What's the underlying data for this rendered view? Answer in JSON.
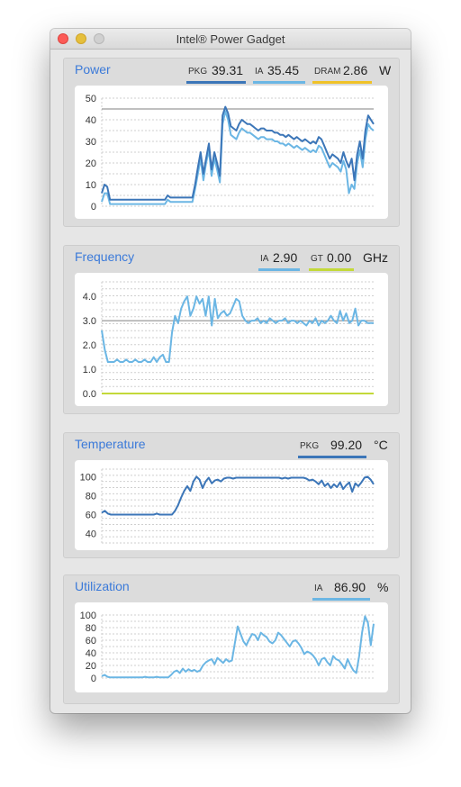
{
  "window": {
    "title": "Intel® Power Gadget"
  },
  "colors": {
    "pkg": "#3c76b8",
    "ia": "#6bb6e4",
    "dram": "#f0c228",
    "gt": "#c3d93a",
    "title_blue": "#3b7ad9"
  },
  "power": {
    "title": "Power",
    "pkg_label": "PKG",
    "pkg_value": "39.31",
    "ia_label": "IA",
    "ia_value": "35.45",
    "dram_label": "DRAM",
    "dram_value": "2.86",
    "unit": "W",
    "chart_data": {
      "type": "line",
      "y_ticks": [
        "50",
        "40",
        "30",
        "20",
        "10",
        "0"
      ],
      "ylim": [
        0,
        50
      ],
      "reference_line": 45,
      "series": [
        {
          "name": "PKG",
          "values": [
            6,
            10,
            9,
            3,
            3,
            3,
            3,
            3,
            3,
            3,
            3,
            3,
            3,
            3,
            3,
            3,
            3,
            3,
            3,
            3,
            3,
            3,
            3,
            3,
            5,
            4,
            4,
            4,
            4,
            4,
            4,
            4,
            4,
            4,
            10,
            18,
            25,
            15,
            22,
            29,
            17,
            25,
            20,
            14,
            42,
            46,
            43,
            37,
            36,
            35,
            38,
            40,
            39,
            38,
            38,
            37,
            36,
            35,
            36,
            36,
            35,
            35,
            35,
            34,
            34,
            33,
            33,
            32,
            33,
            32,
            31,
            32,
            31,
            30,
            31,
            30,
            29,
            30,
            29,
            32,
            31,
            28,
            25,
            22,
            24,
            23,
            22,
            20,
            25,
            21,
            18,
            22,
            12,
            24,
            30,
            22,
            35,
            42,
            40,
            38
          ]
        },
        {
          "name": "IA",
          "values": [
            2,
            6,
            6,
            1,
            1,
            1,
            1,
            1,
            1,
            1,
            1,
            1,
            1,
            1,
            1,
            1,
            1,
            1,
            1,
            1,
            1,
            1,
            1,
            1,
            3,
            2,
            2,
            2,
            2,
            2,
            2,
            2,
            2,
            2,
            8,
            15,
            22,
            12,
            20,
            26,
            14,
            22,
            17,
            11,
            38,
            44,
            40,
            33,
            32,
            31,
            34,
            36,
            35,
            34,
            34,
            33,
            32,
            31,
            32,
            32,
            31,
            31,
            31,
            30,
            30,
            29,
            29,
            28,
            29,
            28,
            27,
            28,
            27,
            26,
            27,
            26,
            25,
            26,
            25,
            28,
            27,
            24,
            21,
            18,
            20,
            19,
            18,
            16,
            21,
            17,
            6,
            10,
            8,
            20,
            26,
            18,
            31,
            38,
            36,
            35
          ]
        }
      ]
    }
  },
  "frequency": {
    "title": "Frequency",
    "ia_label": "IA",
    "ia_value": "2.90",
    "gt_label": "GT",
    "gt_value": "0.00",
    "unit": "GHz",
    "chart_data": {
      "type": "line",
      "y_ticks": [
        "4.0",
        "3.0",
        "2.0",
        "1.0",
        "0.0"
      ],
      "ylim": [
        0,
        4.6
      ],
      "reference_line": 3.0,
      "series": [
        {
          "name": "IA",
          "values": [
            2.6,
            1.8,
            1.3,
            1.3,
            1.3,
            1.4,
            1.3,
            1.3,
            1.4,
            1.3,
            1.3,
            1.4,
            1.3,
            1.3,
            1.4,
            1.3,
            1.3,
            1.5,
            1.3,
            1.5,
            1.6,
            1.3,
            1.3,
            2.5,
            3.2,
            2.9,
            3.5,
            3.8,
            4.0,
            3.2,
            3.5,
            4.0,
            3.7,
            3.9,
            3.2,
            4.0,
            2.8,
            3.9,
            3.1,
            3.3,
            3.4,
            3.2,
            3.3,
            3.6,
            3.9,
            3.8,
            3.2,
            3.0,
            2.9,
            3.0,
            3.0,
            3.1,
            2.9,
            3.0,
            2.9,
            3.1,
            3.0,
            2.9,
            3.0,
            3.0,
            3.1,
            2.9,
            3.0,
            3.0,
            2.9,
            3.0,
            2.9,
            2.8,
            3.0,
            2.9,
            3.1,
            2.8,
            3.0,
            2.9,
            3.0,
            3.2,
            3.0,
            2.9,
            3.4,
            3.0,
            3.3,
            2.9,
            3.0,
            3.5,
            2.8,
            3.0,
            3.0,
            2.9,
            2.9,
            2.9
          ]
        },
        {
          "name": "GT",
          "values": [
            0.0,
            0.0
          ]
        }
      ]
    }
  },
  "temperature": {
    "title": "Temperature",
    "pkg_label": "PKG",
    "pkg_value": "99.20",
    "unit": "°C",
    "chart_data": {
      "type": "line",
      "y_ticks": [
        "100",
        "80",
        "60",
        "40"
      ],
      "ylim": [
        30,
        108
      ],
      "series": [
        {
          "name": "PKG",
          "values": [
            62,
            64,
            61,
            60,
            60,
            60,
            60,
            60,
            60,
            60,
            60,
            60,
            60,
            60,
            60,
            60,
            60,
            60,
            61,
            60,
            60,
            60,
            60,
            60,
            64,
            70,
            78,
            85,
            90,
            85,
            95,
            100,
            97,
            88,
            95,
            99,
            93,
            96,
            97,
            95,
            98,
            99,
            99,
            98,
            99,
            99,
            99,
            99,
            99,
            99,
            99,
            99,
            99,
            99,
            99,
            99,
            99,
            99,
            99,
            98,
            99,
            98,
            99,
            99,
            99,
            99,
            99,
            98,
            96,
            97,
            95,
            92,
            96,
            90,
            93,
            88,
            92,
            89,
            94,
            87,
            91,
            94,
            84,
            93,
            90,
            94,
            99,
            100,
            97,
            92
          ]
        }
      ]
    }
  },
  "utilization": {
    "title": "Utilization",
    "ia_label": "IA",
    "ia_value": "86.90",
    "unit": "%",
    "chart_data": {
      "type": "line",
      "y_ticks": [
        "100",
        "80",
        "60",
        "40",
        "20",
        "0"
      ],
      "ylim": [
        0,
        100
      ],
      "series": [
        {
          "name": "IA",
          "values": [
            3,
            5,
            2,
            1,
            1,
            1,
            1,
            1,
            1,
            1,
            1,
            1,
            1,
            1,
            1,
            2,
            1,
            1,
            1,
            2,
            1,
            1,
            1,
            1,
            5,
            10,
            12,
            8,
            15,
            10,
            14,
            11,
            13,
            10,
            12,
            20,
            25,
            28,
            30,
            22,
            32,
            28,
            24,
            30,
            26,
            28,
            55,
            82,
            70,
            58,
            52,
            62,
            70,
            68,
            60,
            72,
            68,
            65,
            58,
            55,
            60,
            72,
            68,
            62,
            56,
            50,
            58,
            60,
            55,
            48,
            38,
            42,
            40,
            36,
            30,
            20,
            30,
            32,
            25,
            20,
            35,
            30,
            28,
            22,
            15,
            30,
            20,
            12,
            8,
            35,
            72,
            98,
            88,
            52,
            86
          ]
        }
      ]
    }
  }
}
